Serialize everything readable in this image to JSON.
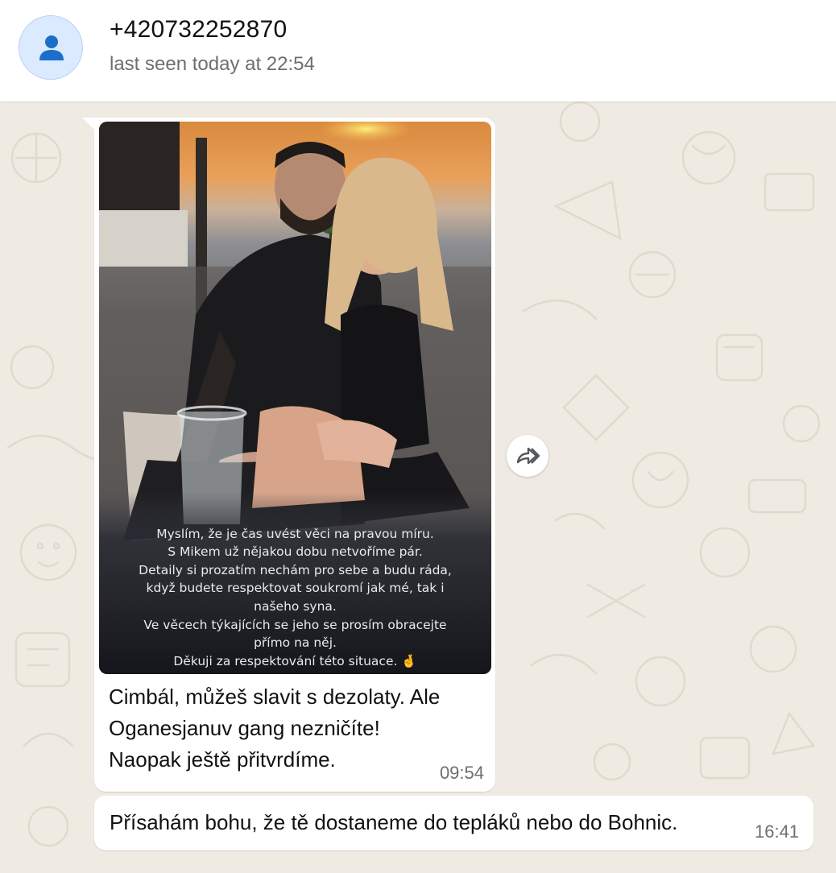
{
  "contact": {
    "name": "+420732252870",
    "status": "last seen today at 22:54"
  },
  "messages": [
    {
      "type": "image",
      "story_overlay_lines": [
        "Myslím, že je čas uvést věci na pravou míru.",
        "S Mikem už nějakou dobu netvoříme pár.",
        "Detaily si prozatím nechám pro sebe a budu ráda,",
        "když budete respektovat soukromí jak mé, tak i",
        "našeho syna.",
        "Ve věcech týkajících se jeho se prosím obracejte",
        "přímo na něj.",
        "Děkuji za respektování této situace. 🤞"
      ],
      "caption_lines": [
        "Cimbál, můžeš slavit s dezolaty. Ale",
        "Oganesjanuv gang nezničíte!",
        "Naopak ještě přitvrdíme."
      ],
      "time": "09:54"
    },
    {
      "type": "text",
      "text": "Přísahám bohu, že tě dostaneme do tepláků nebo do Bohnic.",
      "time": "16:41"
    }
  ],
  "icons": {
    "avatar": "person-icon",
    "forward": "forward-icon"
  },
  "colors": {
    "chat_background": "#efeae2",
    "bubble": "#ffffff",
    "avatar_bg": "#dbeafe",
    "avatar_icon": "#1c6fc9"
  }
}
